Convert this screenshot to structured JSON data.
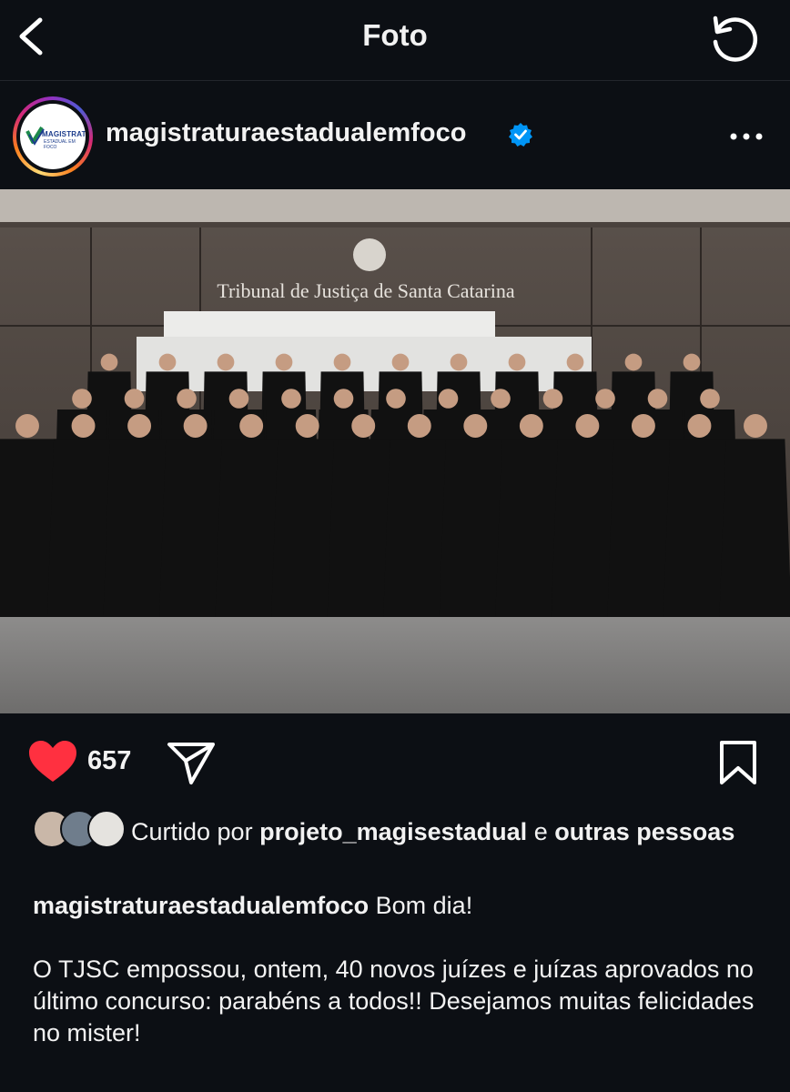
{
  "topbar": {
    "title": "Foto",
    "back_icon": "chevron-left-icon",
    "refresh_icon": "refresh-icon"
  },
  "post": {
    "username": "magistraturaestadualemfoco",
    "verified": true,
    "avatar_logo": {
      "line1": "MAGISTRATURA",
      "line2": "ESTADUAL EM FOCO"
    },
    "photo": {
      "wall_sign": "Tribunal de Justiça de Santa Catarina"
    },
    "like_count": "657",
    "liked_by": {
      "prefix": "Curtido por",
      "user": "projeto_magisestadual",
      "joiner": "e",
      "others": "outras pessoas"
    },
    "caption": {
      "user": "magistraturaestadualemfoco",
      "greeting": "Bom dia!",
      "body": "O TJSC empossou, ontem, 40 novos juízes e juízas aprovados no último concurso: parabéns a todos!! Desejamos muitas felicidades no mister!"
    }
  },
  "colors": {
    "background": "#0c0f14",
    "heart": "#ff3040",
    "verified": "#0095f6"
  }
}
